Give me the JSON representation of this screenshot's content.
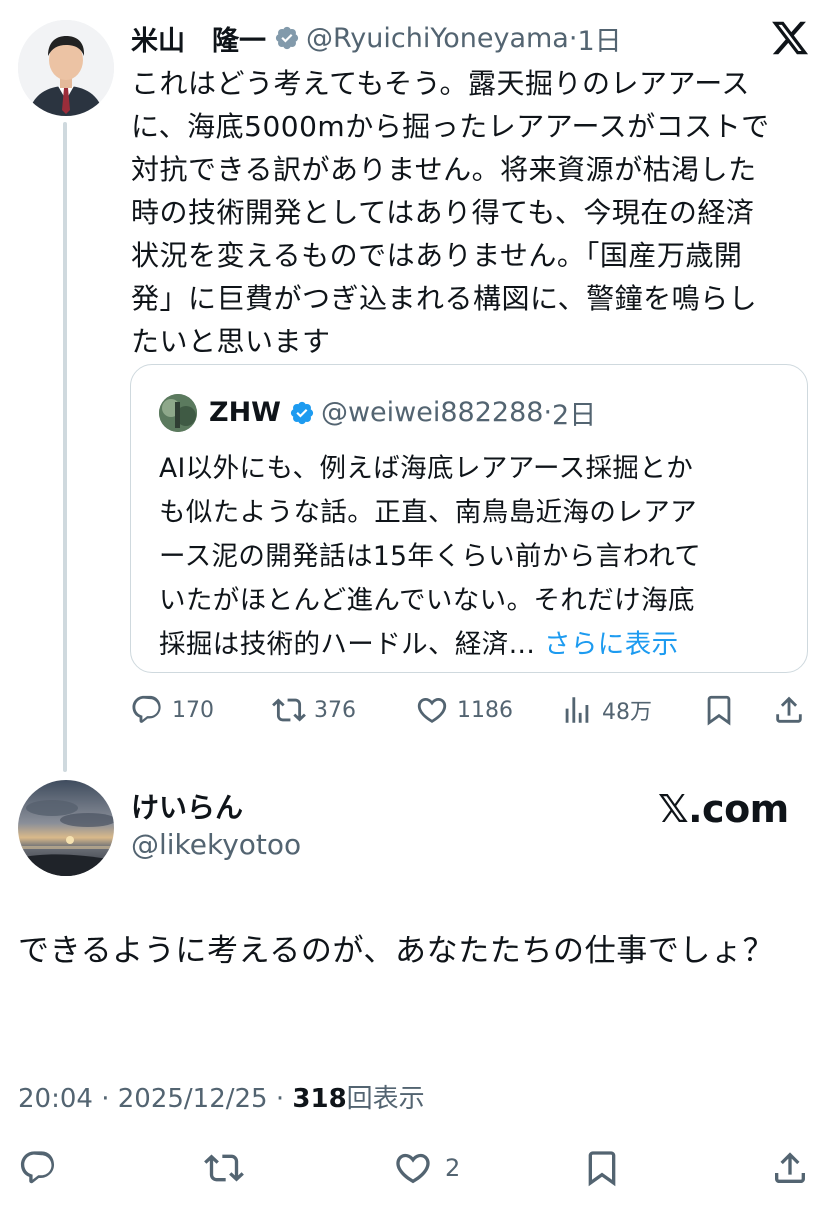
{
  "parent_tweet": {
    "display_name": "米山　隆一",
    "handle": "@RyuichiYoneyama",
    "separator": "·",
    "time_ago": "1日",
    "body": "これはどう考えてもそう。露天掘りのレアアース\nに、海底5000mから掘ったレアアースがコストで\n対抗できる訳がありません。将来資源が枯渇した\n時の技術開発としてはあり得ても、今現在の経済\n状況を変えるものではありません。「国産万歳開\n発」に巨費がつぎ込まれる構図に、警鐘を鳴らし\nたいと思います",
    "quote": {
      "display_name": "ZHW",
      "handle": "@weiwei882288",
      "separator": "·",
      "time_ago": "2日",
      "body": "AI以外にも、例えば海底レアアース採掘とか\nも似たような話。正直、南鳥島近海のレアア\nース泥の開発話は15年くらい前から言われて\nいたがほとんど進んでいない。それだけ海底\n採掘は技術的ハードル、経済... ",
      "show_more": "さらに表示"
    },
    "actions": {
      "replies": "170",
      "reposts": "376",
      "likes": "1186",
      "views": "48万"
    }
  },
  "reply_tweet": {
    "display_name": "けいらん",
    "handle": "@likekyotoo",
    "brand_text": "𝕏.com",
    "body": "できるように考えるのが、あなたたちの仕事でしょ？",
    "time": "20:04",
    "separator": "·",
    "date": "2025/12/25",
    "view_count": "318",
    "view_label": "回表示",
    "actions": {
      "likes": "2"
    }
  },
  "colors": {
    "text": "#0f1419",
    "muted": "#536471",
    "link": "#1d9bf0",
    "verified": "#1d9bf0",
    "border": "#cfd9de"
  },
  "icons": {
    "verified": "verified-badge-icon",
    "x_logo": "x-logo-icon",
    "reply": "reply-icon",
    "repost": "repost-icon",
    "like": "heart-icon",
    "views": "analytics-icon",
    "bookmark": "bookmark-icon",
    "share": "share-icon"
  }
}
